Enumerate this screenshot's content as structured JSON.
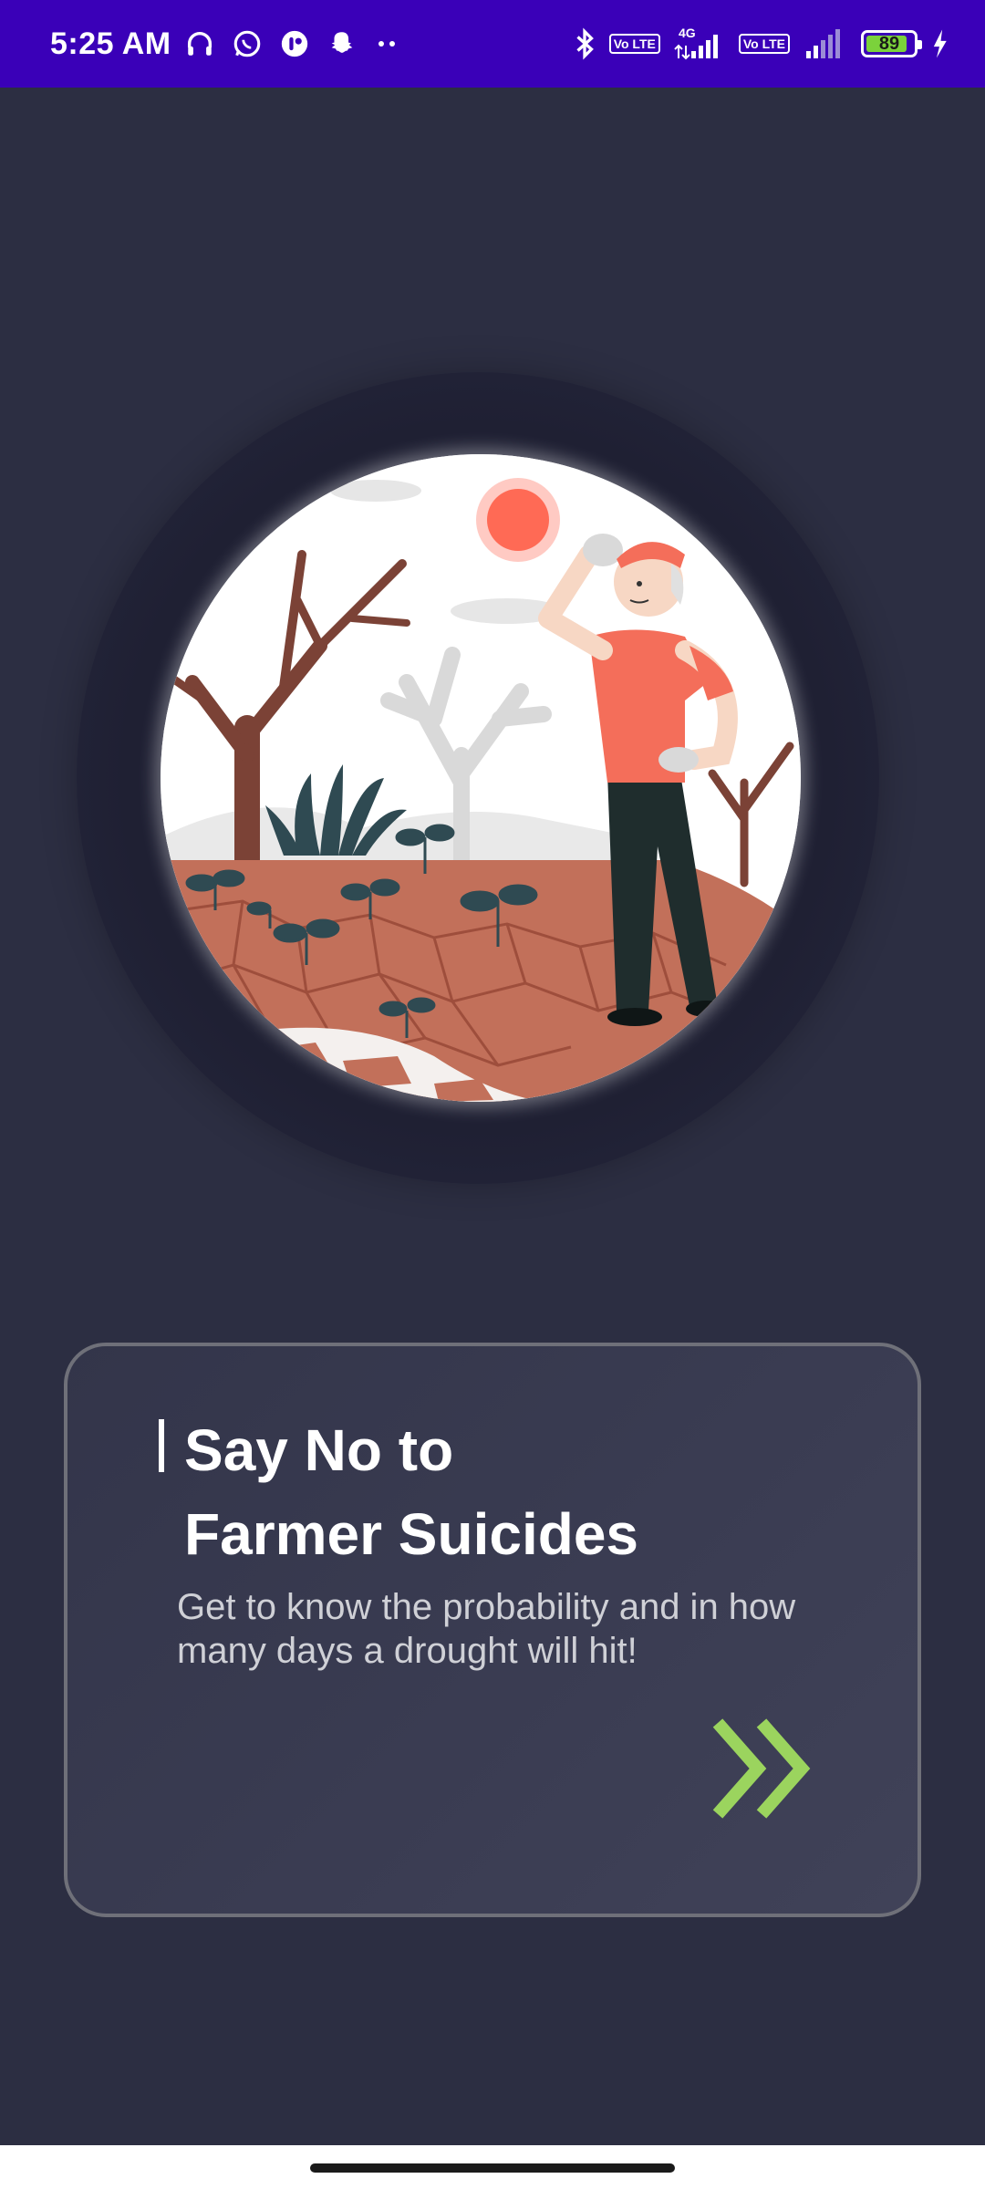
{
  "status_bar": {
    "time": "5:25 AM",
    "left_icons": [
      "headphones-icon",
      "whatsapp-icon",
      "app-notification-icon",
      "snapchat-icon",
      "more-dots-icon"
    ],
    "right_icons": [
      "bluetooth-icon",
      "volte-icon",
      "signal-4g-icon",
      "volte-icon",
      "signal-icon",
      "battery-icon",
      "charging-icon"
    ],
    "network": "4G",
    "volte_label": "Vo LTE",
    "battery": "89",
    "colors": {
      "background": "#3a00b8",
      "battery_fill": "#7bd23b"
    }
  },
  "illustration": {
    "subject": "farmer-in-drought-field-illustration"
  },
  "card": {
    "title_line1": "Say No to",
    "title_line2": "Farmer Suicides",
    "subtitle": "Get to know the probability and in how many days a drought will hit!",
    "next_icon": "double-chevron-right-icon",
    "colors": {
      "accent": "#9bd45e",
      "border": "#6f7079"
    }
  },
  "colors": {
    "page_background": "#2c2e42"
  }
}
